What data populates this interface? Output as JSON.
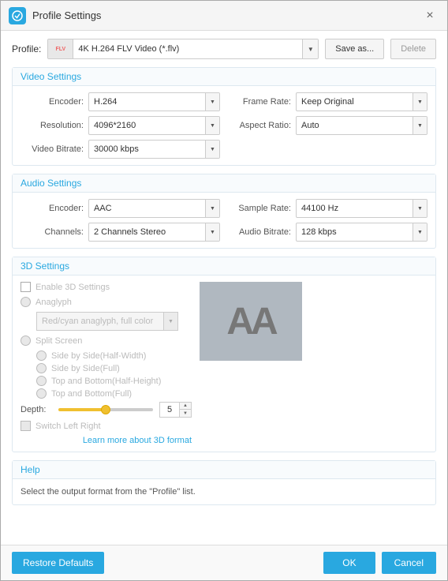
{
  "titleBar": {
    "title": "Profile Settings",
    "closeLabel": "×"
  },
  "profileRow": {
    "label": "Profile:",
    "selectedProfile": "4K H.264 FLV Video (*.flv)",
    "profileIcon": "FLV",
    "saveAsLabel": "Save as...",
    "deleteLabel": "Delete"
  },
  "videoSettings": {
    "sectionTitle": "Video Settings",
    "encoderLabel": "Encoder:",
    "encoderValue": "H.264",
    "frameRateLabel": "Frame Rate:",
    "frameRateValue": "Keep Original",
    "resolutionLabel": "Resolution:",
    "resolutionValue": "4096*2160",
    "aspectRatioLabel": "Aspect Ratio:",
    "aspectRatioValue": "Auto",
    "videoBitrateLabel": "Video Bitrate:",
    "videoBitrateValue": "30000 kbps"
  },
  "audioSettings": {
    "sectionTitle": "Audio Settings",
    "encoderLabel": "Encoder:",
    "encoderValue": "AAC",
    "sampleRateLabel": "Sample Rate:",
    "sampleRateValue": "44100 Hz",
    "channelsLabel": "Channels:",
    "channelsValue": "2 Channels Stereo",
    "audioBitrateLabel": "Audio Bitrate:",
    "audioBitrateValue": "128 kbps"
  },
  "settings3d": {
    "sectionTitle": "3D Settings",
    "enableLabel": "Enable 3D Settings",
    "anaglyphLabel": "Anaglyph",
    "anaglyphOption": "Red/cyan anaglyph, full color",
    "splitScreenLabel": "Split Screen",
    "splitOptions": [
      "Side by Side(Half-Width)",
      "Side by Side(Full)",
      "Top and Bottom(Half-Height)",
      "Top and Bottom(Full)"
    ],
    "depthLabel": "Depth:",
    "depthValue": "5",
    "switchLabel": "Switch Left Right",
    "learnMore": "Learn more about 3D format",
    "aaPreview": "AA"
  },
  "help": {
    "sectionTitle": "Help",
    "helpText": "Select the output format from the \"Profile\" list."
  },
  "footer": {
    "restoreLabel": "Restore Defaults",
    "okLabel": "OK",
    "cancelLabel": "Cancel"
  }
}
